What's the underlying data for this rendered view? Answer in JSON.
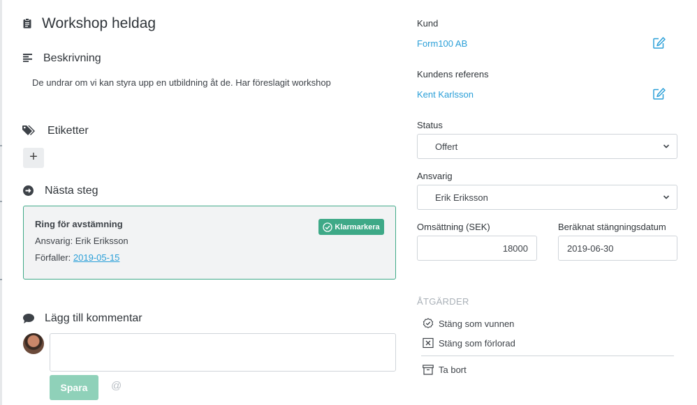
{
  "deal": {
    "title": "Workshop heldag"
  },
  "description": {
    "heading": "Beskrivning",
    "text": "De undrar om vi kan styra upp en utbildning åt de. Har föreslagit workshop"
  },
  "tags": {
    "heading": "Etiketter",
    "add_label": "+"
  },
  "next_step": {
    "heading": "Nästa steg",
    "title": "Ring för avstämning",
    "responsible_line": "Ansvarig: Erik Eriksson",
    "due_prefix": "Förfaller: ",
    "due_date": "2019-05-15",
    "mark_done_label": "Klarmarkera"
  },
  "comment": {
    "heading": "Lägg till kommentar",
    "value": "",
    "save_label": "Spara",
    "mention_symbol": "@"
  },
  "sidebar": {
    "customer_label": "Kund",
    "customer_value": "Form100 AB",
    "reference_label": "Kundens referens",
    "reference_value": "Kent Karlsson",
    "status_label": "Status",
    "status_value": "Offert",
    "responsible_label": "Ansvarig",
    "responsible_value": "Erik Eriksson",
    "revenue_label": "Omsättning (SEK)",
    "revenue_value": "18000",
    "close_date_label": "Beräknat stängningsdatum",
    "close_date_value": "2019-06-30",
    "actions_heading": "ÅTGÄRDER",
    "actions": [
      {
        "label": "Stäng som vunnen",
        "icon": "check-circle-icon"
      },
      {
        "label": "Stäng som förlorad",
        "icon": "x-square-icon"
      },
      {
        "label": "Ta bort",
        "icon": "archive-icon"
      }
    ]
  },
  "colors": {
    "accent": "#3ea987",
    "link": "#2a9fd8",
    "text": "#3d4248"
  }
}
